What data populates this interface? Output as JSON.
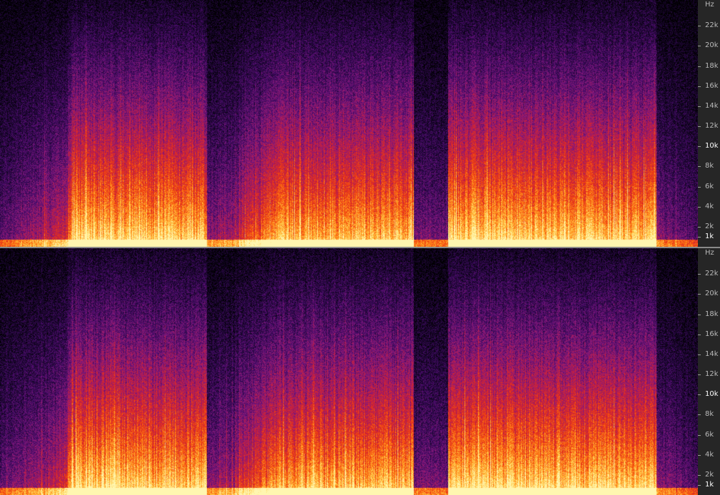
{
  "window": {
    "view": "spectrogram",
    "colormap": [
      "#000000",
      "#1a0630",
      "#4a0c6b",
      "#8a1a7a",
      "#c81e3c",
      "#f04010",
      "#ff8a1a",
      "#ffd050",
      "#fff6b0"
    ]
  },
  "axis": {
    "unit": "Hz",
    "ticks": [
      {
        "label": "22k",
        "hz": 22000,
        "highlight": false
      },
      {
        "label": "20k",
        "hz": 20000,
        "highlight": false
      },
      {
        "label": "18k",
        "hz": 18000,
        "highlight": false
      },
      {
        "label": "16k",
        "hz": 16000,
        "highlight": false
      },
      {
        "label": "14k",
        "hz": 14000,
        "highlight": false
      },
      {
        "label": "12k",
        "hz": 12000,
        "highlight": false
      },
      {
        "label": "10k",
        "hz": 10000,
        "highlight": true
      },
      {
        "label": "8k",
        "hz": 8000,
        "highlight": false
      },
      {
        "label": "6k",
        "hz": 6000,
        "highlight": false
      },
      {
        "label": "4k",
        "hz": 4000,
        "highlight": false
      },
      {
        "label": "2k",
        "hz": 2000,
        "highlight": false
      },
      {
        "label": "1k",
        "hz": 1000,
        "highlight": true
      }
    ],
    "max_hz": 24000
  },
  "channels": [
    {
      "id": "top",
      "unit": "Hz"
    },
    {
      "id": "bottom",
      "unit": "Hz"
    }
  ]
}
